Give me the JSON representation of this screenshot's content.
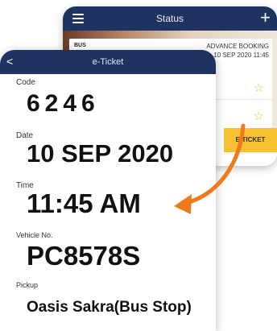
{
  "status_screen": {
    "title": "Status",
    "card": {
      "bus_label": "BUS",
      "booking_type": "ADVANCE BOOKING",
      "booking_datetime": "10 SEP 2020 11:45"
    },
    "eticket_label": "E-TICKET",
    "go_arrow": ">"
  },
  "ticket_screen": {
    "title": "e-Ticket",
    "back_glyph": "<",
    "fields": {
      "code": {
        "label": "Code",
        "value": "6246"
      },
      "date": {
        "label": "Date",
        "value": "10 SEP 2020"
      },
      "time": {
        "label": "Time",
        "value": "11:45 AM"
      },
      "vehicle": {
        "label": "Vehicle No.",
        "value": "PC8578S"
      },
      "pickup": {
        "label": "Pickup",
        "value": "Oasis Sakra(Bus Stop)"
      }
    }
  },
  "colors": {
    "header_navy": "#1f3360",
    "eticket_yellow": "#f6c231",
    "arrow_orange": "#ee7a1c",
    "go_green": "#8cc152",
    "star_gold": "#e9c646"
  }
}
